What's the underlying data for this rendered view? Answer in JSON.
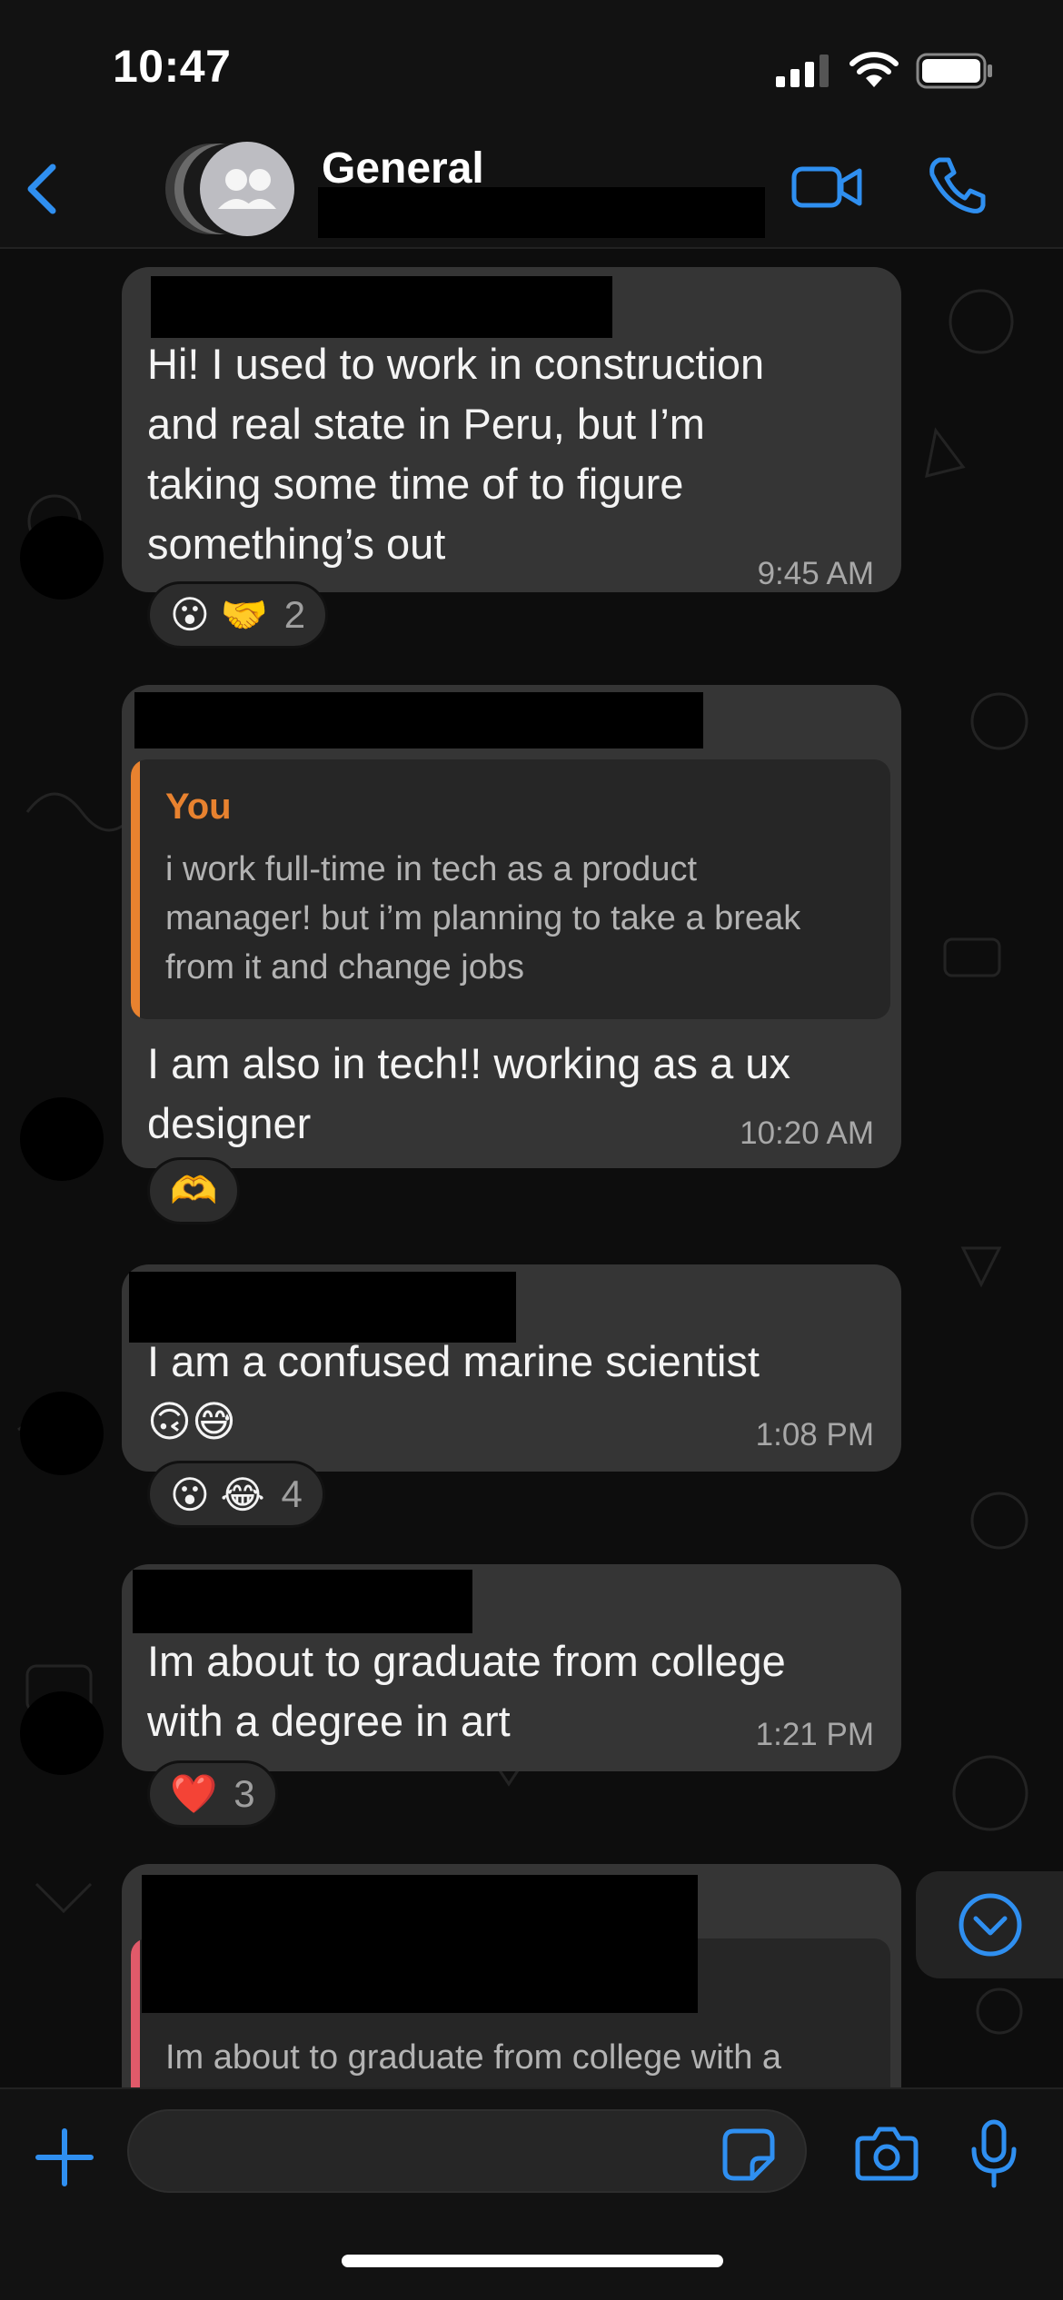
{
  "status_bar": {
    "time": "10:47"
  },
  "header": {
    "title": "General"
  },
  "messages": [
    {
      "text": "Hi! I used to work in construction\nand real state in Peru, but I’m\ntaking some time of to figure\nsomething’s out",
      "time": "9:45 AM",
      "reaction": {
        "emojis": "😮 🤝",
        "count": "2"
      }
    },
    {
      "quote": {
        "author": "You",
        "text": "i work full-time in tech as a product\nmanager! but i’m planning to take a break\nfrom it and change jobs"
      },
      "text": "I am also in tech!! working as a ux\ndesigner",
      "time": "10:20 AM",
      "reaction": {
        "emojis": "🫶",
        "count": ""
      }
    },
    {
      "text": "I am a confused marine scientist\n🙃😅",
      "time": "1:08 PM",
      "reaction": {
        "emojis": "😮 😂",
        "count": "4"
      }
    },
    {
      "text": "Im about to graduate from college\nwith a degree in art",
      "time": "1:21 PM",
      "reaction": {
        "emojis": "❤️",
        "count": "3"
      }
    },
    {
      "quote": {
        "author": "",
        "text": "Im about to graduate from college with a"
      }
    }
  ],
  "composer": {
    "placeholder": ""
  },
  "colors": {
    "accent": "#2f8ff0",
    "bubble": "#353535",
    "quote_author": "#e8822f",
    "quote_bar_you": "#e8822f",
    "quote_bar_other": "#e05a6a"
  },
  "icons": [
    "back-chevron-icon",
    "group-avatar-icon",
    "video-call-icon",
    "phone-call-icon",
    "scroll-down-icon",
    "plus-icon",
    "sticker-icon",
    "camera-icon",
    "microphone-icon"
  ]
}
